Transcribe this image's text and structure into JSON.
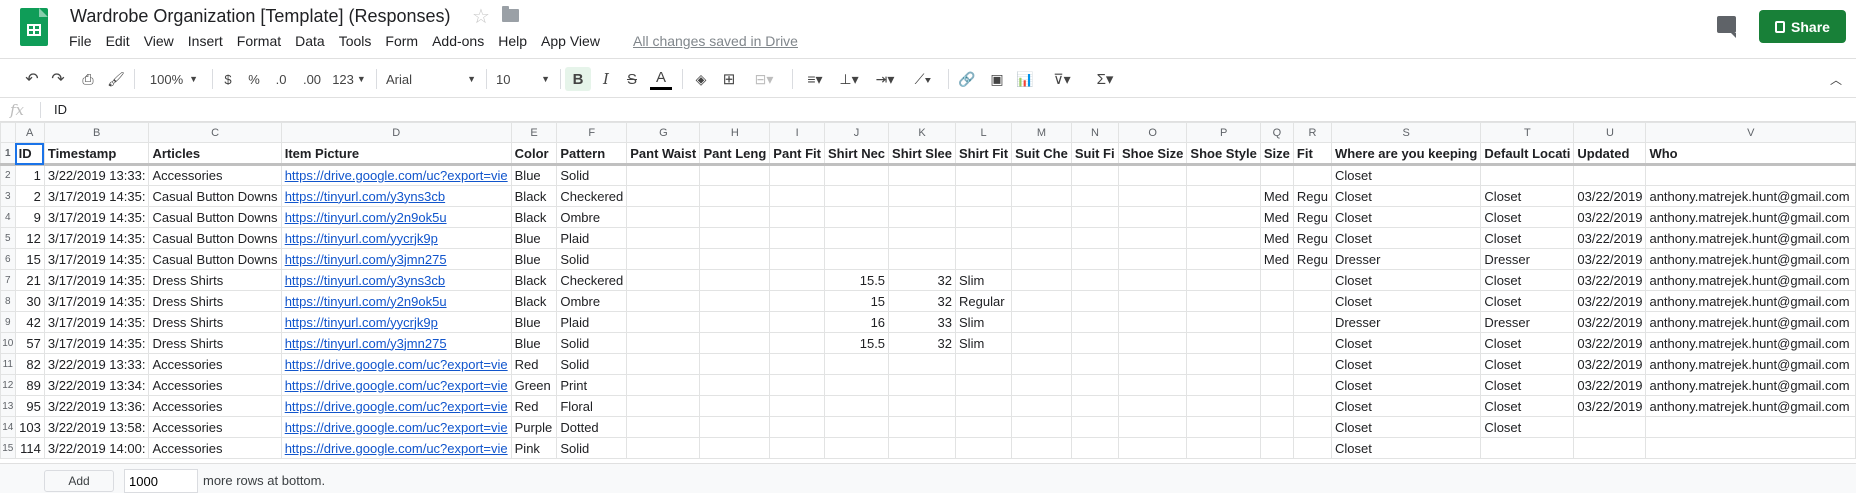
{
  "app": {
    "title": "Wardrobe Organization [Template] (Responses)",
    "saved_status": "All changes saved in Drive",
    "share_label": "Share"
  },
  "menu": [
    "File",
    "Edit",
    "View",
    "Insert",
    "Format",
    "Data",
    "Tools",
    "Form",
    "Add-ons",
    "Help",
    "App View"
  ],
  "toolbar": {
    "zoom": "100%",
    "currency": "$",
    "percent": "%",
    "dec_less": ".0",
    "dec_more": ".00",
    "format_more": "123",
    "font": "Arial",
    "font_size": "10"
  },
  "formula_bar": {
    "fx": "fx",
    "value": "ID"
  },
  "columns": [
    "A",
    "B",
    "C",
    "D",
    "E",
    "F",
    "G",
    "H",
    "I",
    "J",
    "K",
    "L",
    "M",
    "N",
    "O",
    "P",
    "Q",
    "R",
    "S",
    "T",
    "U",
    "V"
  ],
  "headers": [
    "ID",
    "Timestamp",
    "Articles",
    "Item Picture",
    "Color",
    "Pattern",
    "Pant Waist",
    "Pant Leng",
    "Pant Fit",
    "Shirt Nec",
    "Shirt Slee",
    "Shirt Fit",
    "Suit Che",
    "Suit Fi",
    "Shoe Size",
    "Shoe Style",
    "Size",
    "Fit",
    "Where are you keeping",
    "Default Locati",
    "Updated",
    "Who"
  ],
  "rows": [
    {
      "n": "2",
      "c": [
        "1",
        "3/22/2019 13:33:",
        "Accessories",
        "https://drive.google.com/uc?export=vie",
        "Blue",
        "Solid",
        "",
        "",
        "",
        "",
        "",
        "",
        "",
        "",
        "",
        "",
        "",
        "",
        "Closet",
        "",
        "",
        ""
      ]
    },
    {
      "n": "3",
      "c": [
        "2",
        "3/17/2019 14:35:",
        "Casual Button Downs",
        "https://tinyurl.com/y3yns3cb",
        "Black",
        "Checkered",
        "",
        "",
        "",
        "",
        "",
        "",
        "",
        "",
        "",
        "",
        "Med",
        "Regu",
        "Closet",
        "Closet",
        "03/22/2019",
        "anthony.matrejek.hunt@gmail.com"
      ]
    },
    {
      "n": "4",
      "c": [
        "9",
        "3/17/2019 14:35:",
        "Casual Button Downs",
        "https://tinyurl.com/y2n9ok5u",
        "Black",
        "Ombre",
        "",
        "",
        "",
        "",
        "",
        "",
        "",
        "",
        "",
        "",
        "Med",
        "Regu",
        "Closet",
        "Closet",
        "03/22/2019",
        "anthony.matrejek.hunt@gmail.com"
      ]
    },
    {
      "n": "5",
      "c": [
        "12",
        "3/17/2019 14:35:",
        "Casual Button Downs",
        "https://tinyurl.com/yycrjk9p",
        "Blue",
        "Plaid",
        "",
        "",
        "",
        "",
        "",
        "",
        "",
        "",
        "",
        "",
        "Med",
        "Regu",
        "Closet",
        "Closet",
        "03/22/2019",
        "anthony.matrejek.hunt@gmail.com"
      ]
    },
    {
      "n": "6",
      "c": [
        "15",
        "3/17/2019 14:35:",
        "Casual Button Downs",
        "https://tinyurl.com/y3jmn275",
        "Blue",
        "Solid",
        "",
        "",
        "",
        "",
        "",
        "",
        "",
        "",
        "",
        "",
        "Med",
        "Regu",
        "Dresser",
        "Dresser",
        "03/22/2019",
        "anthony.matrejek.hunt@gmail.com"
      ]
    },
    {
      "n": "7",
      "c": [
        "21",
        "3/17/2019 14:35:",
        "Dress Shirts",
        "https://tinyurl.com/y3yns3cb",
        "Black",
        "Checkered",
        "",
        "",
        "",
        "15.5",
        "32",
        "Slim",
        "",
        "",
        "",
        "",
        "",
        "",
        "Closet",
        "Closet",
        "03/22/2019",
        "anthony.matrejek.hunt@gmail.com"
      ]
    },
    {
      "n": "8",
      "c": [
        "30",
        "3/17/2019 14:35:",
        "Dress Shirts",
        "https://tinyurl.com/y2n9ok5u",
        "Black",
        "Ombre",
        "",
        "",
        "",
        "15",
        "32",
        "Regular",
        "",
        "",
        "",
        "",
        "",
        "",
        "Closet",
        "Closet",
        "03/22/2019",
        "anthony.matrejek.hunt@gmail.com"
      ]
    },
    {
      "n": "9",
      "c": [
        "42",
        "3/17/2019 14:35:",
        "Dress Shirts",
        "https://tinyurl.com/yycrjk9p",
        "Blue",
        "Plaid",
        "",
        "",
        "",
        "16",
        "33",
        "Slim",
        "",
        "",
        "",
        "",
        "",
        "",
        "Dresser",
        "Dresser",
        "03/22/2019",
        "anthony.matrejek.hunt@gmail.com"
      ]
    },
    {
      "n": "10",
      "c": [
        "57",
        "3/17/2019 14:35:",
        "Dress Shirts",
        "https://tinyurl.com/y3jmn275",
        "Blue",
        "Solid",
        "",
        "",
        "",
        "15.5",
        "32",
        "Slim",
        "",
        "",
        "",
        "",
        "",
        "",
        "Closet",
        "Closet",
        "03/22/2019",
        "anthony.matrejek.hunt@gmail.com"
      ]
    },
    {
      "n": "11",
      "c": [
        "82",
        "3/22/2019 13:33:",
        "Accessories",
        "https://drive.google.com/uc?export=vie",
        "Red",
        "Solid",
        "",
        "",
        "",
        "",
        "",
        "",
        "",
        "",
        "",
        "",
        "",
        "",
        "Closet",
        "Closet",
        "03/22/2019",
        "anthony.matrejek.hunt@gmail.com"
      ]
    },
    {
      "n": "12",
      "c": [
        "89",
        "3/22/2019 13:34:",
        "Accessories",
        "https://drive.google.com/uc?export=vie",
        "Green",
        "Print",
        "",
        "",
        "",
        "",
        "",
        "",
        "",
        "",
        "",
        "",
        "",
        "",
        "Closet",
        "Closet",
        "03/22/2019",
        "anthony.matrejek.hunt@gmail.com"
      ]
    },
    {
      "n": "13",
      "c": [
        "95",
        "3/22/2019 13:36:",
        "Accessories",
        "https://drive.google.com/uc?export=vie",
        "Red",
        "Floral",
        "",
        "",
        "",
        "",
        "",
        "",
        "",
        "",
        "",
        "",
        "",
        "",
        "Closet",
        "Closet",
        "03/22/2019",
        "anthony.matrejek.hunt@gmail.com"
      ]
    },
    {
      "n": "14",
      "c": [
        "103",
        "3/22/2019 13:58:",
        "Accessories",
        "https://drive.google.com/uc?export=vie",
        "Purple",
        "Dotted",
        "",
        "",
        "",
        "",
        "",
        "",
        "",
        "",
        "",
        "",
        "",
        "",
        "Closet",
        "Closet",
        "",
        ""
      ]
    },
    {
      "n": "15",
      "c": [
        "114",
        "3/22/2019 14:00:",
        "Accessories",
        "https://drive.google.com/uc?export=vie",
        "Pink",
        "Solid",
        "",
        "",
        "",
        "",
        "",
        "",
        "",
        "",
        "",
        "",
        "",
        "",
        "Closet",
        "",
        "",
        ""
      ]
    }
  ],
  "footer": {
    "add_label": "Add",
    "rows_value": "1000",
    "more_rows_text": "more rows at bottom."
  }
}
